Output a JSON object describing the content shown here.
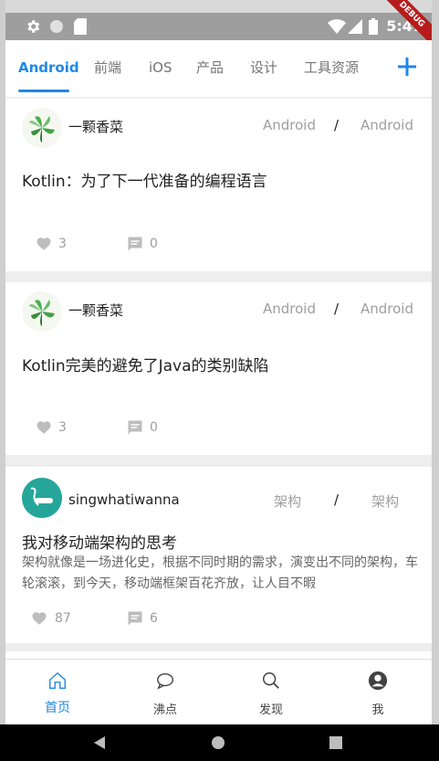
{
  "status_bar": {
    "time": "5:47",
    "debug_ribbon": "DEBUG"
  },
  "tabs": [
    {
      "label": "Android",
      "active": true
    },
    {
      "label": "前端"
    },
    {
      "label": "iOS"
    },
    {
      "label": "产品"
    },
    {
      "label": "设计"
    },
    {
      "label": "工具资源"
    }
  ],
  "add_icon": "plus-icon",
  "posts": [
    {
      "author": "一颗香菜",
      "category": "Android",
      "subcategory": "Android",
      "title": "Kotlin：为了下一代准备的编程语言",
      "summary": "",
      "likes": "3",
      "comments": "0"
    },
    {
      "author": "一颗香菜",
      "category": "Android",
      "subcategory": "Android",
      "title": "Kotlin完美的避免了Java的类别缺陷",
      "summary": "",
      "likes": "3",
      "comments": "0"
    },
    {
      "author": "singwhatiwanna",
      "category": "架构",
      "subcategory": "架构",
      "title": "我对移动端架构的思考",
      "summary": "架构就像是一场进化史，根据不同时期的需求，演变出不同的架构，车轮滚滚，到今天，移动端框架百花齐放，让人目不暇",
      "likes": "87",
      "comments": "6"
    }
  ],
  "separator": "/",
  "bottom_nav": [
    {
      "label": "首页",
      "icon": "home-icon",
      "active": true
    },
    {
      "label": "沸点",
      "icon": "chat-bubble-icon"
    },
    {
      "label": "发现",
      "icon": "search-icon"
    },
    {
      "label": "我",
      "icon": "person-icon"
    }
  ],
  "colors": {
    "accent": "#1e88e5",
    "muted": "#9e9e9e",
    "text": "#212121"
  }
}
